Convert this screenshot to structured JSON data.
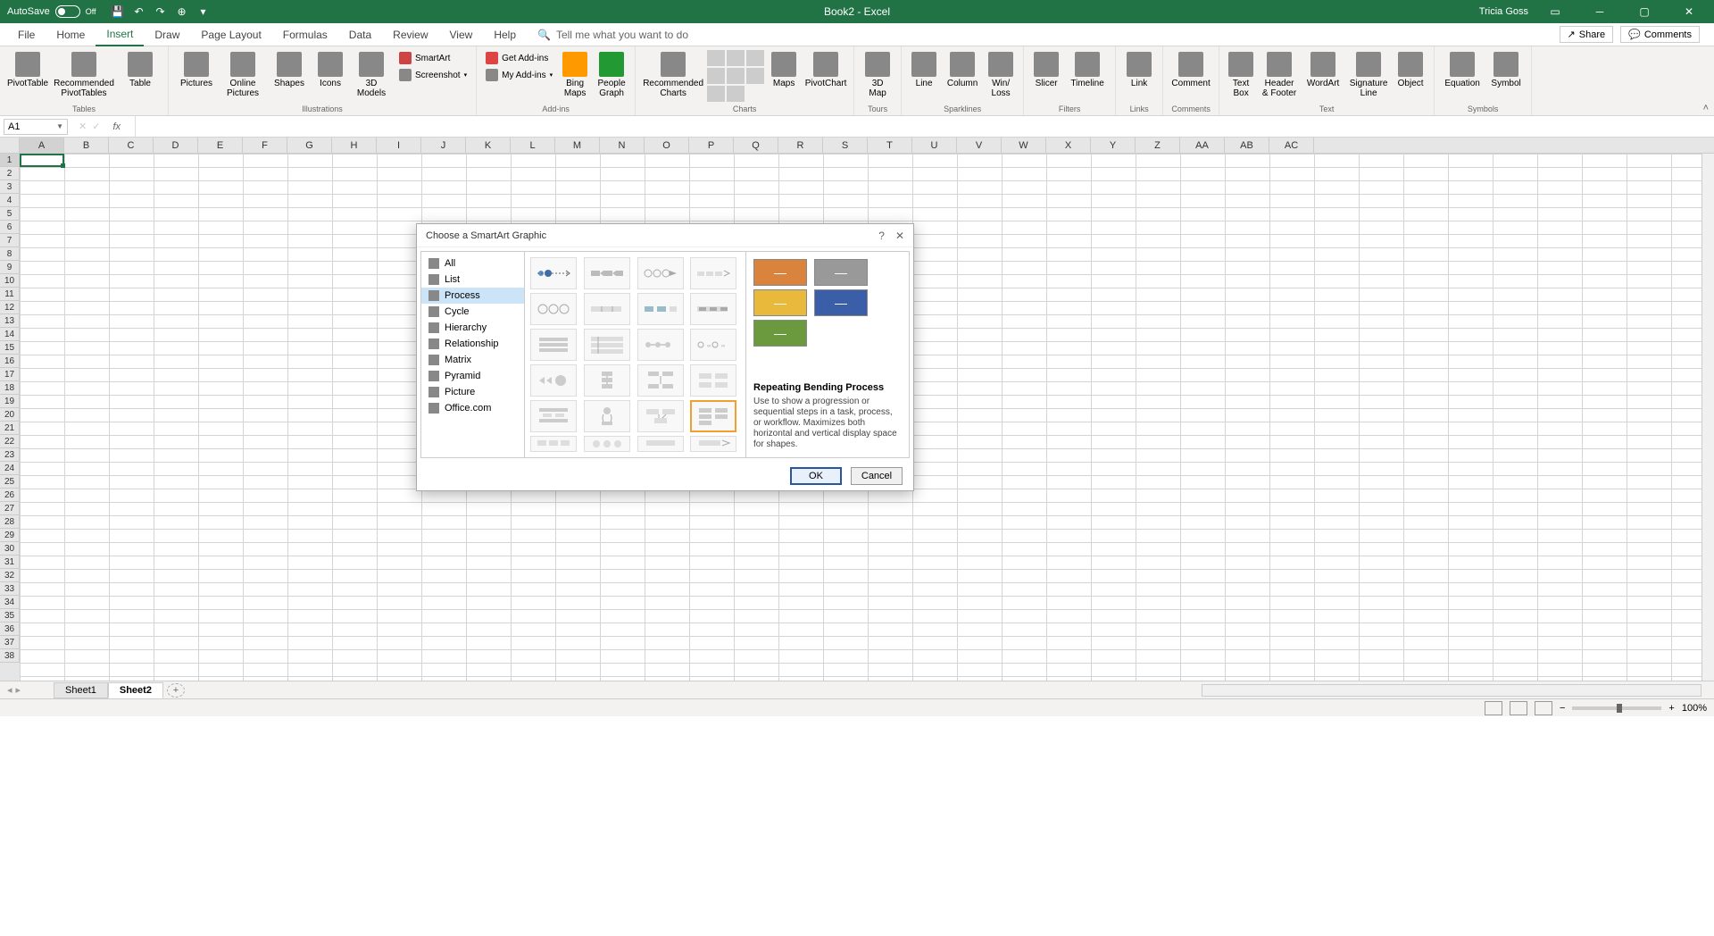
{
  "titlebar": {
    "autosave_label": "AutoSave",
    "autosave_state": "Off",
    "app_title": "Book2 - Excel",
    "username": "Tricia Goss"
  },
  "tabs": {
    "file": "File",
    "home": "Home",
    "insert": "Insert",
    "draw": "Draw",
    "pagelayout": "Page Layout",
    "formulas": "Formulas",
    "data": "Data",
    "review": "Review",
    "view": "View",
    "help": "Help",
    "search_placeholder": "Tell me what you want to do",
    "share": "Share",
    "comments": "Comments"
  },
  "ribbon": {
    "groups": {
      "tables": {
        "label": "Tables",
        "pivottable": "PivotTable",
        "recommended_pt": "Recommended\nPivotTables",
        "table": "Table"
      },
      "illustrations": {
        "label": "Illustrations",
        "pictures": "Pictures",
        "online_pictures": "Online\nPictures",
        "shapes": "Shapes",
        "icons": "Icons",
        "models3d": "3D\nModels",
        "smartart": "SmartArt",
        "screenshot": "Screenshot"
      },
      "addins": {
        "label": "Add-ins",
        "getaddins": "Get Add-ins",
        "myaddins": "My Add-ins",
        "bing": "Bing\nMaps",
        "people": "People\nGraph"
      },
      "charts": {
        "label": "Charts",
        "recommended": "Recommended\nCharts",
        "maps": "Maps",
        "pivotchart": "PivotChart"
      },
      "tours": {
        "label": "Tours",
        "map3d": "3D\nMap"
      },
      "sparklines": {
        "label": "Sparklines",
        "line": "Line",
        "column": "Column",
        "winloss": "Win/\nLoss"
      },
      "filters": {
        "label": "Filters",
        "slicer": "Slicer",
        "timeline": "Timeline"
      },
      "links": {
        "label": "Links",
        "link": "Link"
      },
      "comments": {
        "label": "Comments",
        "comment": "Comment"
      },
      "text": {
        "label": "Text",
        "textbox": "Text\nBox",
        "header": "Header\n& Footer",
        "wordart": "WordArt",
        "signature": "Signature\nLine",
        "object": "Object"
      },
      "symbols": {
        "label": "Symbols",
        "equation": "Equation",
        "symbol": "Symbol"
      }
    }
  },
  "formula_bar": {
    "name_box": "A1",
    "fx": "fx"
  },
  "columns": [
    "A",
    "B",
    "C",
    "D",
    "E",
    "F",
    "G",
    "H",
    "I",
    "J",
    "K",
    "L",
    "M",
    "N",
    "O",
    "P",
    "Q",
    "R",
    "S",
    "T",
    "U",
    "V",
    "W",
    "X",
    "Y",
    "Z",
    "AA",
    "AB",
    "AC"
  ],
  "rows_count": 38,
  "sheets": {
    "tab1": "Sheet1",
    "tab2": "Sheet2"
  },
  "status": {
    "zoom": "100%"
  },
  "dialog": {
    "title": "Choose a SmartArt Graphic",
    "categories": {
      "all": "All",
      "list": "List",
      "process": "Process",
      "cycle": "Cycle",
      "hierarchy": "Hierarchy",
      "relationship": "Relationship",
      "matrix": "Matrix",
      "pyramid": "Pyramid",
      "picture": "Picture",
      "office": "Office.com"
    },
    "preview": {
      "name": "Repeating Bending Process",
      "description": "Use to show a progression or sequential steps in a task, process, or workflow. Maximizes both horizontal and vertical display space for shapes."
    },
    "ok": "OK",
    "cancel": "Cancel"
  }
}
